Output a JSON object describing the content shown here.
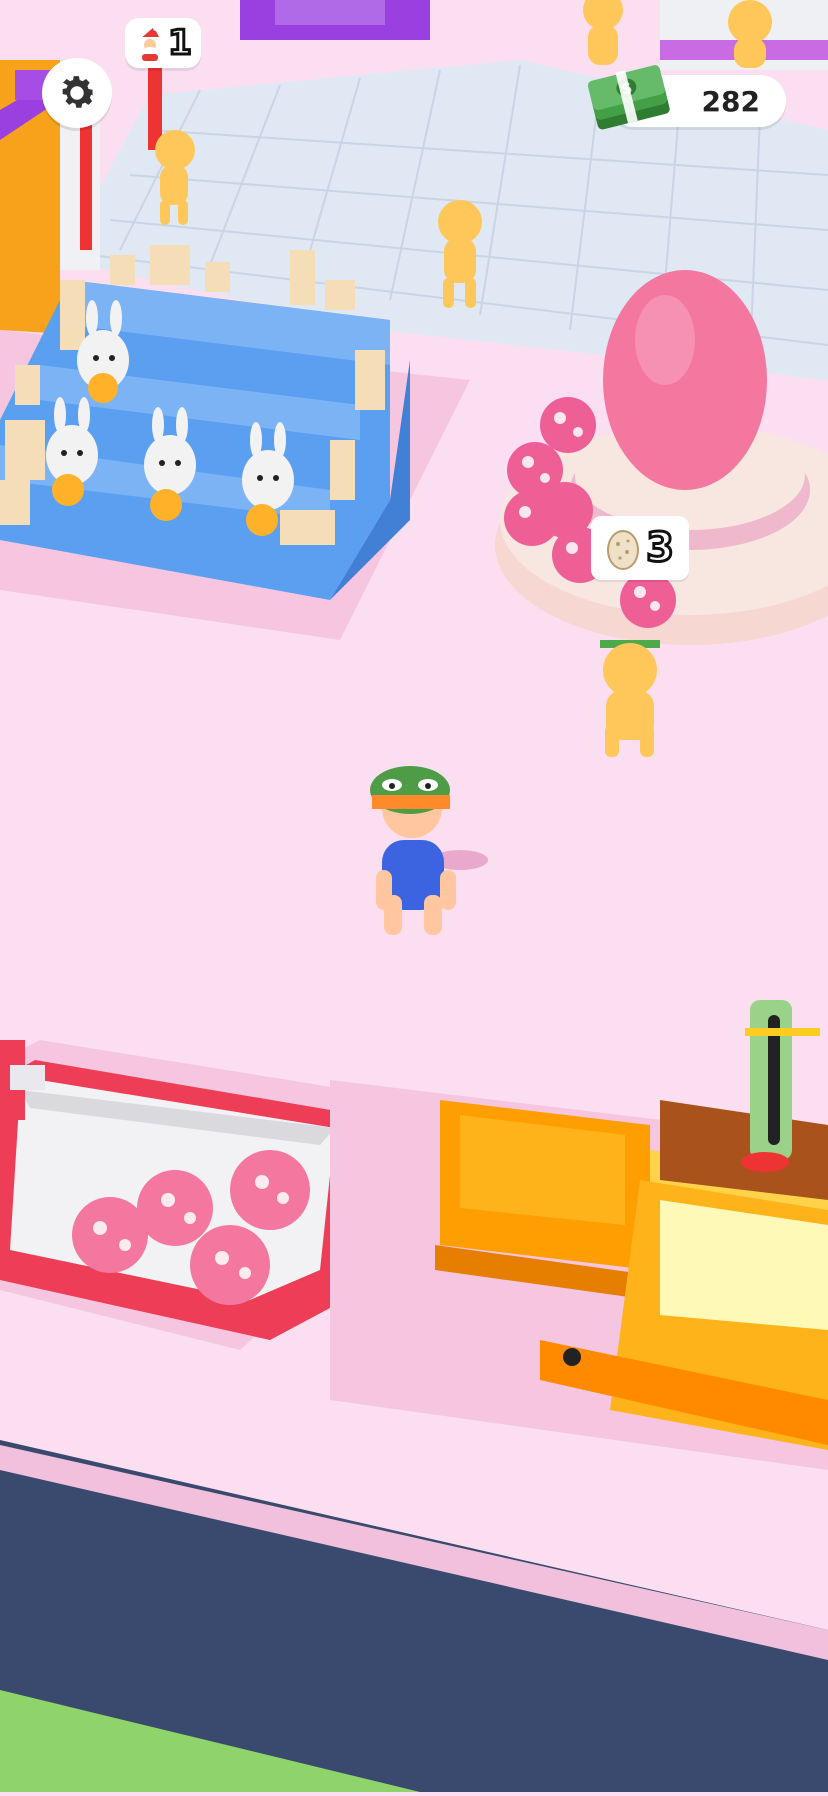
{
  "hud": {
    "santa_count": "1",
    "money": "282"
  },
  "egg_station": {
    "egg_count": "3"
  },
  "icons": {
    "settings": "gear-icon",
    "santa": "santa-icon",
    "money": "cash-stack-icon",
    "egg": "egg-icon"
  },
  "colors": {
    "floor": "#fbdff0",
    "platform": "#f6c6e0",
    "blue_stand": "#5b9ff0",
    "red_tray": "#ee3e57",
    "yellow_machine": "#ffb31a",
    "void": "#3a4a6e",
    "grass": "#8fd46a",
    "money_green": "#4ea14e"
  }
}
